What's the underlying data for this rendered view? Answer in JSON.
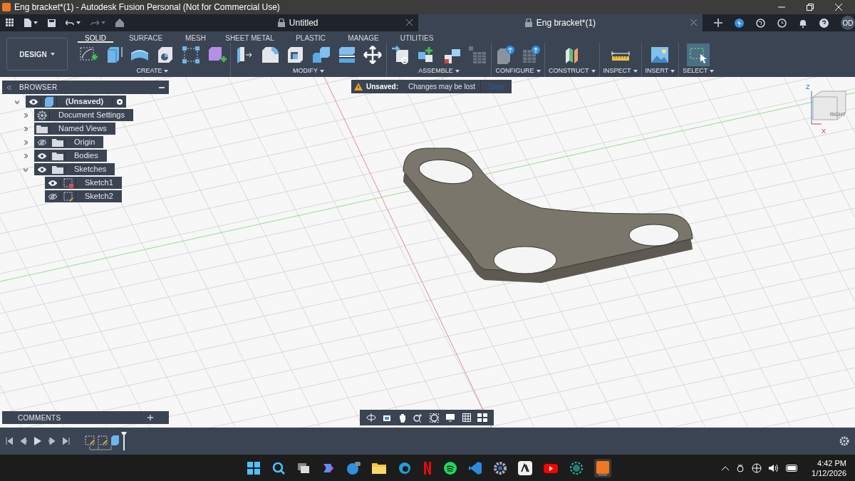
{
  "window": {
    "title": "Eng bracket*(1) - Autodesk Fusion Personal (Not for Commercial Use)"
  },
  "document_tabs": [
    {
      "label": "Untitled",
      "selected": false
    },
    {
      "label": "Eng bracket*(1)",
      "selected": true
    }
  ],
  "user": {
    "initials": "OD"
  },
  "workspace": {
    "label": "DESIGN"
  },
  "ribbon_tabs": [
    {
      "label": "SOLID",
      "selected": true
    },
    {
      "label": "SURFACE",
      "selected": false
    },
    {
      "label": "MESH",
      "selected": false
    },
    {
      "label": "SHEET METAL",
      "selected": false
    },
    {
      "label": "PLASTIC",
      "selected": false
    },
    {
      "label": "MANAGE",
      "selected": false
    },
    {
      "label": "UTILITIES",
      "selected": false
    }
  ],
  "ribbon_groups": [
    {
      "label": "CREATE"
    },
    {
      "label": "MODIFY"
    },
    {
      "label": "ASSEMBLE"
    },
    {
      "label": "CONFIGURE"
    },
    {
      "label": "CONSTRUCT"
    },
    {
      "label": "INSPECT"
    },
    {
      "label": "INSERT"
    },
    {
      "label": "SELECT"
    }
  ],
  "browser": {
    "title": "BROWSER",
    "tree": [
      {
        "label": "(Unsaved)",
        "kind": "component",
        "visible": true,
        "expanded": true,
        "children": [
          {
            "label": "Document Settings",
            "kind": "settings",
            "expanded": false
          },
          {
            "label": "Named Views",
            "kind": "folder",
            "expanded": false
          },
          {
            "label": "Origin",
            "kind": "folder",
            "visible": false,
            "expanded": false
          },
          {
            "label": "Bodies",
            "kind": "folder",
            "visible": true,
            "expanded": false
          },
          {
            "label": "Sketches",
            "kind": "folder",
            "visible": true,
            "expanded": true,
            "children": [
              {
                "label": "Sketch1",
                "kind": "sketch",
                "visible": true
              },
              {
                "label": "Sketch2",
                "kind": "sketch",
                "visible": false
              }
            ]
          }
        ]
      }
    ]
  },
  "notice": {
    "label": "Unsaved:",
    "message": "Changes may be lost",
    "action": "Save"
  },
  "viewcube": {
    "face": "RIGHT",
    "z_label": "Z",
    "x_label": "X"
  },
  "comments": {
    "title": "COMMENTS"
  },
  "taskbar": {
    "time": "4:42 PM",
    "date": "1/12/2026"
  }
}
